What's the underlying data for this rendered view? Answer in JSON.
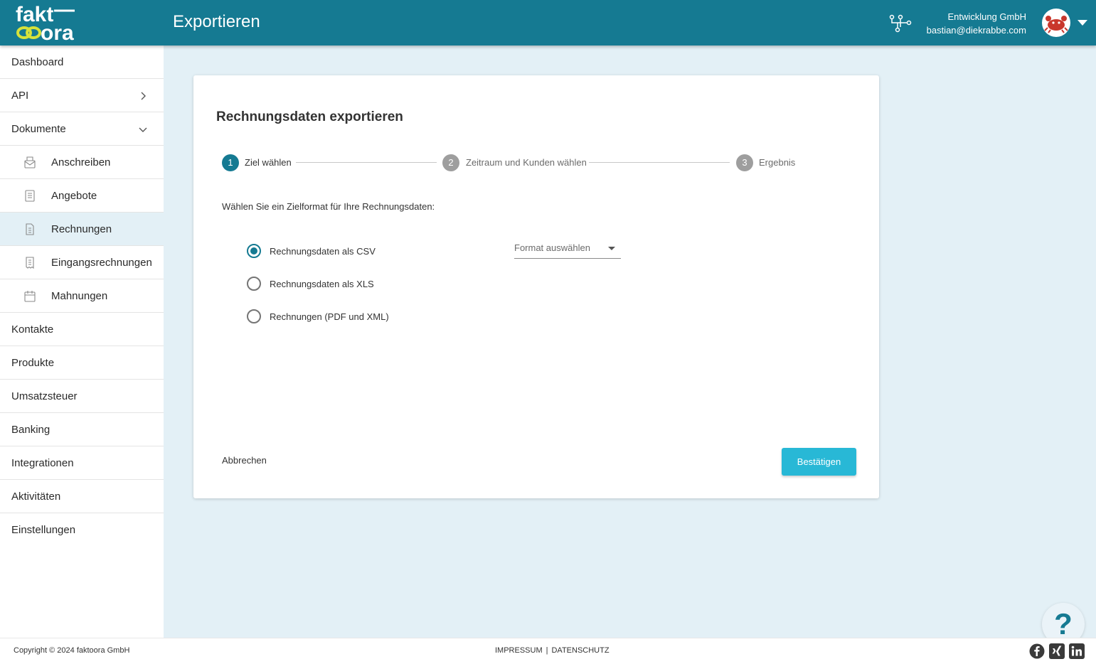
{
  "header": {
    "page_title": "Exportieren",
    "company": "Entwicklung GmbH",
    "email": "bastian@diekrabbe.com",
    "icons": [
      "org-chart-icon",
      "avatar",
      "chevron-down-icon"
    ]
  },
  "logo": {
    "text_top": "fakt",
    "text_bottom": "ora"
  },
  "sidebar": {
    "items": [
      {
        "label": "Dashboard"
      },
      {
        "label": "API",
        "icon": "chevron-right-icon"
      },
      {
        "label": "Dokumente",
        "icon": "chevron-down-icon"
      },
      {
        "label": "Anschreiben",
        "icon": "letter-icon"
      },
      {
        "label": "Angebote",
        "icon": "document-list-icon"
      },
      {
        "label": "Rechnungen",
        "icon": "invoice-icon"
      },
      {
        "label": "Eingangsrechnungen",
        "icon": "receipt-icon"
      },
      {
        "label": "Mahnungen",
        "icon": "calendar-icon"
      },
      {
        "label": "Kontakte"
      },
      {
        "label": "Produkte"
      },
      {
        "label": "Umsatzsteuer"
      },
      {
        "label": "Banking"
      },
      {
        "label": "Integrationen"
      },
      {
        "label": "Aktivitäten"
      },
      {
        "label": "Einstellungen"
      }
    ],
    "active": "Rechnungen"
  },
  "card": {
    "title": "Rechnungsdaten exportieren",
    "steps": [
      {
        "number": "1",
        "label": "Ziel wählen",
        "state": "active"
      },
      {
        "number": "2",
        "label": "Zeitraum und Kunden wählen",
        "state": "inactive"
      },
      {
        "number": "3",
        "label": "Ergebnis",
        "state": "inactive"
      }
    ],
    "intro": "Wählen Sie ein Zielformat für Ihre Rechnungsdaten:",
    "options": [
      {
        "label": "Rechnungsdaten als CSV",
        "checked": true
      },
      {
        "label": "Rechnungsdaten als XLS",
        "checked": false
      },
      {
        "label": "Rechnungen (PDF und XML)",
        "checked": false
      }
    ],
    "format_select": {
      "placeholder": "Format auswählen"
    },
    "cancel_label": "Abbrechen",
    "confirm_label": "Bestätigen"
  },
  "help": {
    "label": "?"
  },
  "footer": {
    "copyright": "Copyright © 2024 faktoora GmbH",
    "impressum": "IMPRESSUM",
    "separator": "|",
    "datenschutz": "DATENSCHUTZ",
    "social": [
      "facebook-icon",
      "xing-icon",
      "linkedin-icon"
    ]
  },
  "colors": {
    "primary": "#157a92",
    "accent": "#28b8d6",
    "background": "#e3f0f6",
    "logo_yellow": "#d6e23a",
    "step_inactive": "#9e9e9e"
  }
}
